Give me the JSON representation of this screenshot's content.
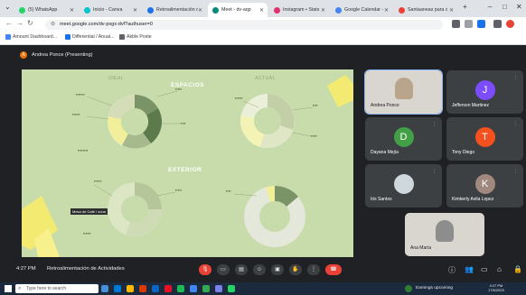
{
  "browser": {
    "tabs": [
      {
        "label": "(5) WhatsApp",
        "color": "#25d366"
      },
      {
        "label": "Inicio - Canva",
        "color": "#00c4cc"
      },
      {
        "label": "Retroalimentación de",
        "color": "#1a73e8"
      },
      {
        "label": "Meet - dv-aqp",
        "color": "#00897b",
        "active": true
      },
      {
        "label": "Instagram • Stats",
        "color": "#e1306c"
      },
      {
        "label": "Google Calendar - W",
        "color": "#4285f4"
      },
      {
        "label": "Santaaneas para c",
        "color": "#ea4335"
      }
    ],
    "new_tab": "+",
    "url": "meet.google.com/dv-pxgx-dvf?authuser=0",
    "bookmarks": [
      "Amount Dashboard...",
      "Differential / Anual...",
      "Akble Poste"
    ]
  },
  "meet": {
    "presenter_initial": "A",
    "presenter_label": "Andrea Ponce (Presenting)",
    "slide": {
      "section1": "ESPACIOS",
      "col_ideal": "IDEAL",
      "col_actual": "ACTUAL",
      "section2": "EXTERIOR",
      "tooltip": "Mesa de Café / zona"
    },
    "participants": [
      {
        "name": "Andrea Ponce",
        "initial": "",
        "color": "#b9a58c",
        "video": true
      },
      {
        "name": "Jefferson Martinez",
        "initial": "J",
        "color": "#7c4dff"
      },
      {
        "name": "Dayana Mejía",
        "initial": "D",
        "color": "#43a047"
      },
      {
        "name": "Tony Diego",
        "initial": "T",
        "color": "#f4511e"
      },
      {
        "name": "Iris Santos",
        "initial": "",
        "color": "#cfd8dc"
      },
      {
        "name": "Kimberly Avila Lopez",
        "initial": "K",
        "color": "#a1887f"
      },
      {
        "name": "Ana María",
        "initial": "",
        "color": "#8d8d8d",
        "video": true
      }
    ],
    "time": "4:27 PM",
    "meeting_title": "Retroalimentación de Actividades"
  },
  "taskbar": {
    "search_placeholder": "Type here to search",
    "tray_text": "Earnings upcoming",
    "clock_time": "4:27 PM",
    "clock_date": "17/6/2023"
  }
}
